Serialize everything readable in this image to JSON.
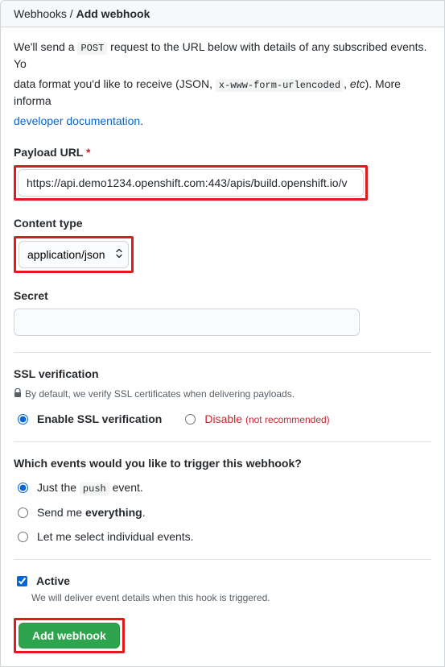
{
  "breadcrumb": {
    "parent": "Webhooks",
    "sep": " / ",
    "current": "Add webhook"
  },
  "intro": {
    "t1": "We'll send a ",
    "post": "POST",
    "t2": " request to the URL below with details of any subscribed events. Yo",
    "t3": "data format you'd like to receive (JSON, ",
    "enc": "x-www-form-urlencoded",
    "t4": ", ",
    "etc": "etc",
    "t5": "). More informa",
    "link": "developer documentation",
    "dot": "."
  },
  "payload_url": {
    "label": "Payload URL",
    "required": "*",
    "value": "https://api.demo1234.openshift.com:443/apis/build.openshift.io/v"
  },
  "content_type": {
    "label": "Content type",
    "value": "application/json"
  },
  "secret": {
    "label": "Secret",
    "value": ""
  },
  "ssl": {
    "title": "SSL verification",
    "note": "By default, we verify SSL certificates when delivering payloads.",
    "enable": "Enable SSL verification",
    "disable": "Disable ",
    "disable_note": "(not recommended)"
  },
  "events": {
    "title": "Which events would you like to trigger this webhook?",
    "just_a": "Just the ",
    "push": "push",
    "just_b": " event.",
    "everything_a": "Send me ",
    "everything_b": "everything",
    "everything_c": ".",
    "individual": "Let me select individual events."
  },
  "active": {
    "label": "Active",
    "desc": "We will deliver event details when this hook is triggered."
  },
  "submit": {
    "label": "Add webhook"
  }
}
